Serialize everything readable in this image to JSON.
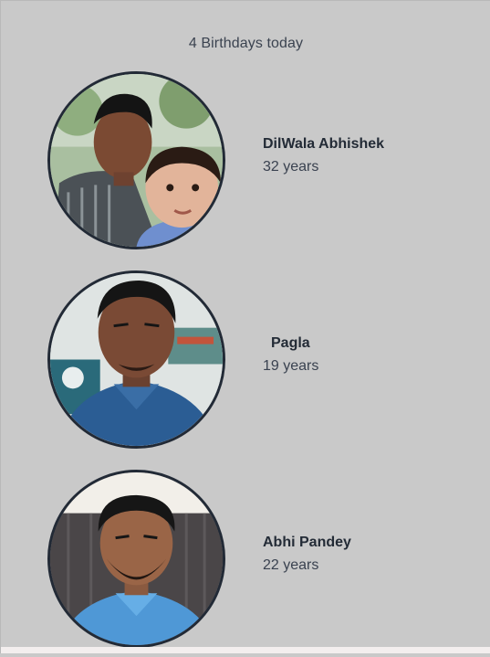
{
  "header": {
    "title": "4 Birthdays today"
  },
  "people": [
    {
      "name": "DilWala Abhishek",
      "age": "32 years",
      "avatar_icon": "photo-two-people"
    },
    {
      "name": "Pagla",
      "age": "19 years",
      "avatar_icon": "photo-person-blue-shirt"
    },
    {
      "name": "Abhi Pandey",
      "age": "22 years",
      "avatar_icon": "photo-person-light-blue-shirt"
    }
  ],
  "colors": {
    "background": "#c9c9c9",
    "avatar_border": "#222a36",
    "name_text": "#232b36"
  }
}
